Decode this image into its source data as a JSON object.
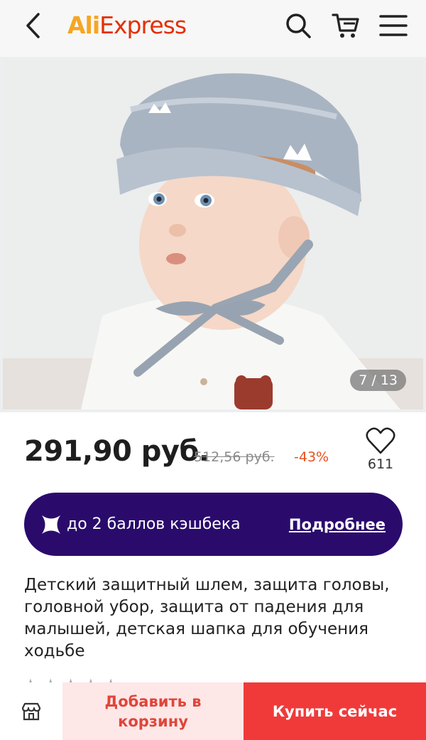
{
  "header": {
    "logo_part1": "Ali",
    "logo_part2": "Express",
    "icons": [
      "back-arrow-icon",
      "search-icon",
      "cart-icon",
      "menu-icon"
    ]
  },
  "gallery": {
    "counter": "7 / 13"
  },
  "price": {
    "current": "291,90 руб.",
    "old": "512,56 руб.",
    "discount": "-43%",
    "wishlist_count": "611"
  },
  "cashback": {
    "text": "до 2 баллов кэшбека",
    "link": "Подробнее",
    "color": "#2a0b6c"
  },
  "product": {
    "title": "Детский защитный шлем, защита головы, головной убор, защита от падения для малышей, детская шапка для обучения ходьбе"
  },
  "bottom_bar": {
    "add_to_cart": "Добавить в корзину",
    "buy_now": "Купить сейчас",
    "accent": "#f03a3a"
  }
}
